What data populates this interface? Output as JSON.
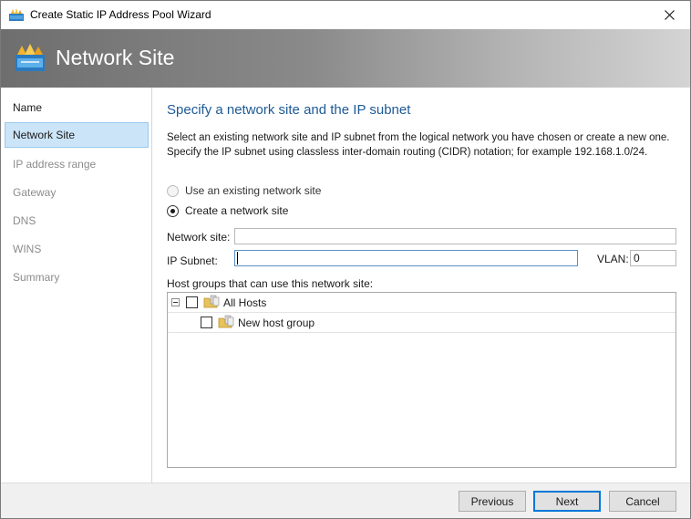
{
  "window": {
    "title": "Create Static IP Address Pool Wizard",
    "app_icon": "wizard-app-icon",
    "close_icon": "close-icon"
  },
  "banner": {
    "title": "Network Site",
    "icon": "network-site-icon"
  },
  "nav": {
    "items": [
      {
        "label": "Name",
        "state": "done"
      },
      {
        "label": "Network Site",
        "state": "active"
      },
      {
        "label": "IP address range",
        "state": "pending"
      },
      {
        "label": "Gateway",
        "state": "pending"
      },
      {
        "label": "DNS",
        "state": "pending"
      },
      {
        "label": "WINS",
        "state": "pending"
      },
      {
        "label": "Summary",
        "state": "pending"
      }
    ]
  },
  "main": {
    "heading": "Specify a network site and the IP subnet",
    "description": "Select an existing network site and IP subnet from the logical network you have chosen or create a new one. Specify the IP subnet using classless inter-domain routing (CIDR) notation; for example 192.168.1.0/24.",
    "options": [
      {
        "label": "Use an existing network site",
        "selected": false,
        "enabled": false
      },
      {
        "label": "Create a network site",
        "selected": true,
        "enabled": true
      }
    ],
    "network_site": {
      "label": "Network site:",
      "value": ""
    },
    "ip_subnet": {
      "label": "IP Subnet:",
      "value": ""
    },
    "vlan": {
      "label": "VLAN:",
      "value": "0"
    },
    "host_groups": {
      "label": "Host groups that can use this network site:",
      "tree": [
        {
          "label": "All Hosts",
          "checked": false,
          "expanded": true,
          "icon": "host-group-folder-icon"
        },
        {
          "label": "New host group",
          "checked": false,
          "icon": "host-group-folder-icon"
        }
      ]
    }
  },
  "footer": {
    "previous": "Previous",
    "next": "Next",
    "cancel": "Cancel"
  },
  "colors": {
    "heading": "#1e5a96",
    "nav_active_bg": "#cce4f7",
    "nav_active_border": "#99c9ef",
    "default_button_border": "#0078d7"
  }
}
